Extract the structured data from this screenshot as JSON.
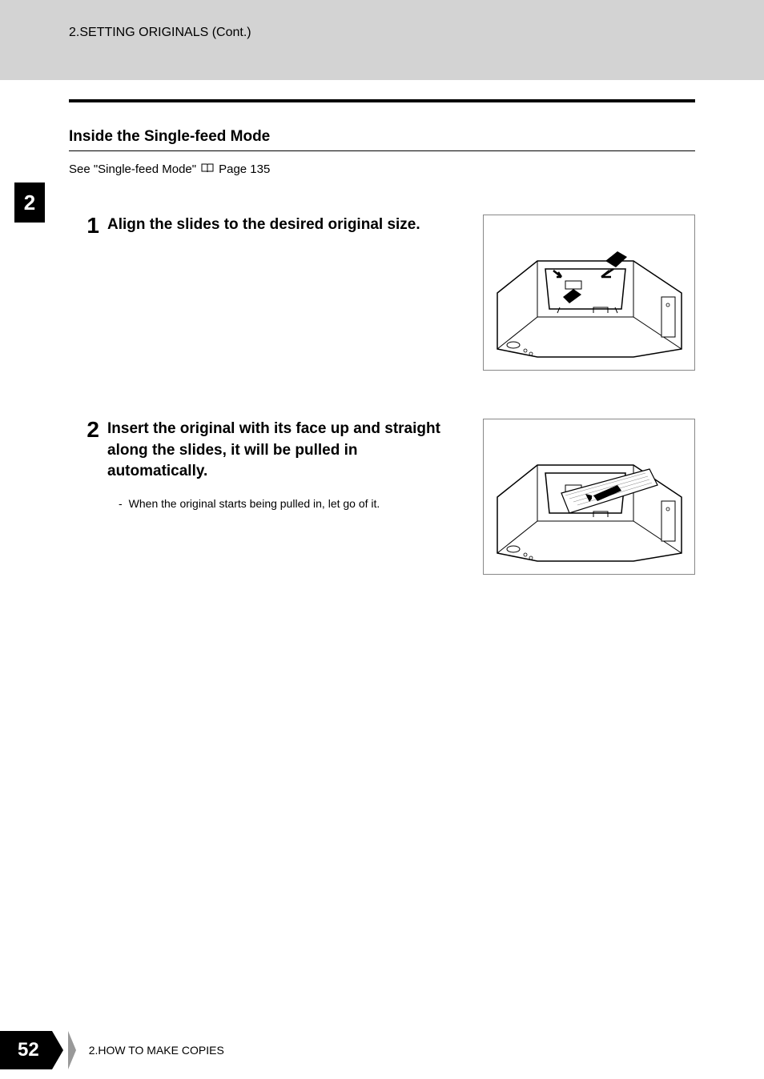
{
  "header": {
    "breadcrumb": "2.SETTING ORIGINALS (Cont.)"
  },
  "chapter": {
    "tab_number": "2"
  },
  "section": {
    "title": "Inside the Single-feed Mode",
    "reference_prefix": "See \"Single-feed Mode\" ",
    "reference_page": " Page 135"
  },
  "steps": [
    {
      "number": "1",
      "title": "Align the slides to the desired original size.",
      "notes": []
    },
    {
      "number": "2",
      "title": "Insert the original with its face up and straight along the slides, it will be pulled in automatically.",
      "notes": [
        "When the original starts being pulled in, let go of it."
      ]
    }
  ],
  "footer": {
    "page_number": "52",
    "chapter_label": "2.HOW TO MAKE COPIES"
  }
}
